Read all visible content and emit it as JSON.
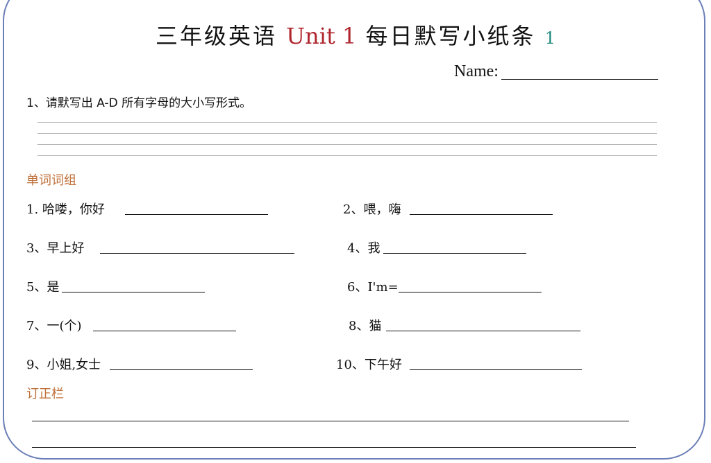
{
  "title": {
    "prefix": "三年级英语",
    "unit": "Unit 1",
    "suffix": "每日默写小纸条",
    "number": "1"
  },
  "name_label": "Name:",
  "question1": "1、请默写出 A-D 所有字母的大小写形式。",
  "sections": {
    "words": "单词词组",
    "correction": "订正栏"
  },
  "items": [
    "1. 哈喽，你好",
    "2、喂，嗨",
    "3、早上好",
    "4、我",
    "5、是",
    "6、I'm=",
    "7、一(个)",
    "8、猫",
    "9、小姐,女士",
    "10、下午好"
  ],
  "colors": {
    "border": "#6b7fb8",
    "unit_red": "#b0262e",
    "number_teal": "#1f8a7e",
    "section_orange": "#c0703a"
  }
}
